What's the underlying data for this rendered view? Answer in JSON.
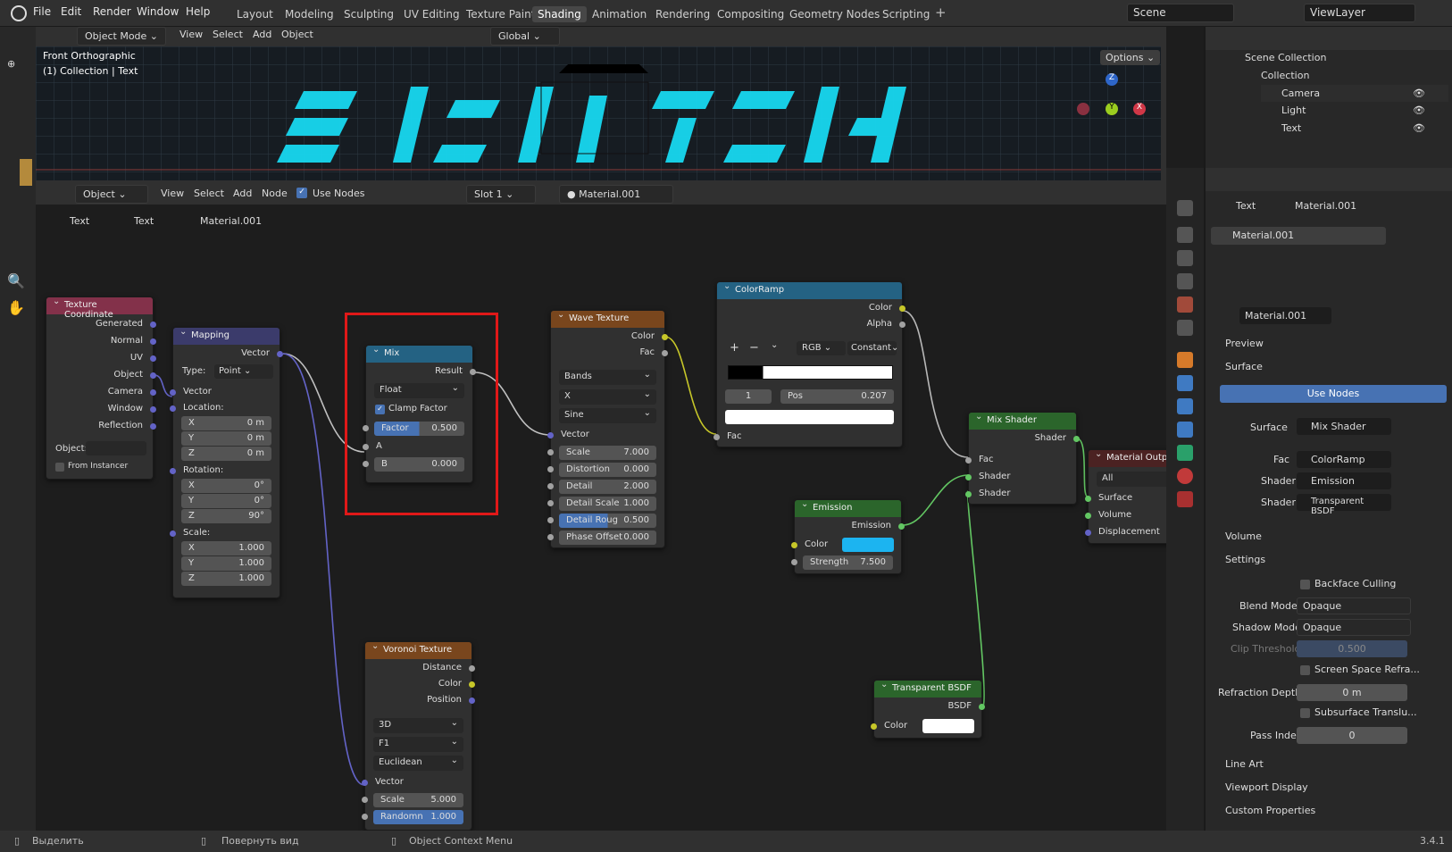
{
  "menu": {
    "file": "File",
    "edit": "Edit",
    "render": "Render",
    "window": "Window",
    "help": "Help"
  },
  "workspaces": [
    "Layout",
    "Modeling",
    "Sculpting",
    "UV Editing",
    "Texture Paint",
    "Shading",
    "Animation",
    "Rendering",
    "Compositing",
    "Geometry Nodes",
    "Scripting"
  ],
  "active_workspace": "Shading",
  "scene": "Scene",
  "view_layer": "ViewLayer",
  "viewport": {
    "mode": "Object Mode",
    "view": "View",
    "select": "Select",
    "add": "Add",
    "object": "Object",
    "orientation": "Global",
    "options": "Options",
    "info_line1": "Front Orthographic",
    "info_line2": "(1) Collection | Text"
  },
  "node_header": {
    "type": "Object",
    "view": "View",
    "select": "Select",
    "add": "Add",
    "node": "Node",
    "use_nodes": "Use Nodes",
    "slot": "Slot 1",
    "material": "Material.001"
  },
  "breadcrumb": [
    "Text",
    "Text",
    "Material.001"
  ],
  "nodes": {
    "texcoord": {
      "title": "Texture Coordinate",
      "outputs": [
        "Generated",
        "Normal",
        "UV",
        "Object",
        "Camera",
        "Window",
        "Reflection"
      ],
      "object_label": "Object:",
      "from_instancer": "From Instancer"
    },
    "mapping": {
      "title": "Mapping",
      "output": "Vector",
      "type_label": "Type:",
      "type_value": "Point",
      "vector": "Vector",
      "location": "Location:",
      "loc": [
        [
          "X",
          "0 m"
        ],
        [
          "Y",
          "0 m"
        ],
        [
          "Z",
          "0 m"
        ]
      ],
      "rotation": "Rotation:",
      "rot": [
        [
          "X",
          "0°"
        ],
        [
          "Y",
          "0°"
        ],
        [
          "Z",
          "90°"
        ]
      ],
      "scale": "Scale:",
      "scl": [
        [
          "X",
          "1.000"
        ],
        [
          "Y",
          "1.000"
        ],
        [
          "Z",
          "1.000"
        ]
      ]
    },
    "mix": {
      "title": "Mix",
      "output": "Result",
      "data_type": "Float",
      "clamp": "Clamp Factor",
      "factor_label": "Factor",
      "factor_value": "0.500",
      "a": "A",
      "b_label": "B",
      "b_value": "0.000"
    },
    "wave": {
      "title": "Wave Texture",
      "outputs": [
        "Color",
        "Fac"
      ],
      "type": "Bands",
      "axis": "X",
      "profile": "Sine",
      "vector": "Vector",
      "fields": [
        [
          "Scale",
          "7.000"
        ],
        [
          "Distortion",
          "0.000"
        ],
        [
          "Detail",
          "2.000"
        ],
        [
          "Detail Scale",
          "1.000"
        ],
        [
          "Detail Roug",
          "0.500"
        ],
        [
          "Phase Offset",
          "0.000"
        ]
      ]
    },
    "colorramp": {
      "title": "ColorRamp",
      "outputs": [
        "Color",
        "Alpha"
      ],
      "plus": "+",
      "minus": "−",
      "mode": "RGB",
      "interp": "Constant",
      "index": "1",
      "pos_label": "Pos",
      "pos_value": "0.207",
      "input": "Fac"
    },
    "voronoi": {
      "title": "Voronoi Texture",
      "outputs": [
        "Distance",
        "Color",
        "Position"
      ],
      "dim": "3D",
      "feature": "F1",
      "metric": "Euclidean",
      "vector": "Vector",
      "scale_label": "Scale",
      "scale_value": "5.000",
      "random_label": "Randomn",
      "random_value": "1.000"
    },
    "emission": {
      "title": "Emission",
      "output": "Emission",
      "color_label": "Color",
      "color": "#1cb4f0",
      "strength_label": "Strength",
      "strength_value": "7.500"
    },
    "mixshader": {
      "title": "Mix Shader",
      "output": "Shader",
      "inputs": [
        "Fac",
        "Shader",
        "Shader"
      ]
    },
    "transparent": {
      "title": "Transparent BSDF",
      "output": "BSDF",
      "color_label": "Color"
    },
    "output": {
      "title": "Material Output",
      "target": "All",
      "inputs": [
        "Surface",
        "Volume",
        "Displacement"
      ]
    }
  },
  "outliner": {
    "root": "Scene Collection",
    "collection": "Collection",
    "items": [
      "Camera",
      "Light",
      "Text"
    ]
  },
  "properties": {
    "crumb_obj": "Text",
    "crumb_mat": "Material.001",
    "slot_item": "Material.001",
    "material_name": "Material.001",
    "preview": "Preview",
    "surface": "Surface",
    "use_nodes": "Use Nodes",
    "surface_label": "Surface",
    "surface_value": "Mix Shader",
    "fac_label": "Fac",
    "fac_value": "ColorRamp",
    "shader1_label": "Shader",
    "shader1_value": "Emission",
    "shader2_label": "Shader",
    "shader2_value": "Transparent BSDF",
    "volume": "Volume",
    "settings": "Settings",
    "backface": "Backface Culling",
    "blend_label": "Blend Mode",
    "blend_value": "Opaque",
    "shadow_label": "Shadow Mode",
    "shadow_value": "Opaque",
    "clip_label": "Clip Threshold",
    "clip_value": "0.500",
    "ssr": "Screen Space Refra...",
    "refr_label": "Refraction Depth",
    "refr_value": "0 m",
    "sss": "Subsurface Translu...",
    "pass_label": "Pass Index",
    "pass_value": "0",
    "line_art": "Line Art",
    "viewport_display": "Viewport Display",
    "custom_props": "Custom Properties"
  },
  "status": {
    "select": "Выделить",
    "rotate": "Повернуть вид",
    "context": "Object Context Menu",
    "version": "3.4.1"
  }
}
